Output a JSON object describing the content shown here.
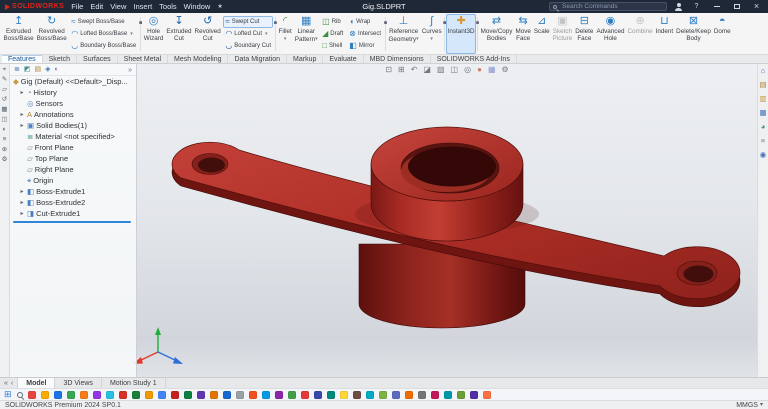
{
  "titlebar": {
    "logo_text": "SOLIDWORKS",
    "brand_color": "#e2231a",
    "menus": [
      "File",
      "Edit",
      "View",
      "Insert",
      "Tools",
      "Window"
    ],
    "pin_icon": "menu-pin-icon",
    "document_title": "Gig.SLDPRT",
    "search_placeholder": "Search Commands",
    "help_label": "?"
  },
  "ribbon": {
    "items": [
      {
        "icon": "extruded-boss-base-icon",
        "l1": "Extruded",
        "l2": "Boss/Base"
      },
      {
        "icon": "revolved-boss-base-icon",
        "l1": "Revolved",
        "l2": "Boss/Base"
      },
      {
        "stack": true,
        "items": [
          {
            "icon": "swept-boss-base-icon",
            "label": "Swept Boss/Base"
          },
          {
            "icon": "lofted-boss-base-icon",
            "label": "Lofted Boss/Base",
            "caret": true
          },
          {
            "icon": "boundary-boss-base-icon",
            "label": "Boundary Boss/Base"
          }
        ]
      },
      {
        "sep": true
      },
      {
        "icon": "hole-wizard-icon",
        "l1": "Hole",
        "l2": "Wizard"
      },
      {
        "icon": "extruded-cut-icon",
        "l1": "Extruded",
        "l2": "Cut"
      },
      {
        "icon": "revolved-cut-icon",
        "l1": "Revolved",
        "l2": "Cut"
      },
      {
        "stack": true,
        "items": [
          {
            "icon": "swept-cut-icon",
            "label": "Swept Cut",
            "highlight": true
          },
          {
            "icon": "lofted-cut-icon",
            "label": "Lofted Cut",
            "caret": true
          },
          {
            "icon": "boundary-cut-icon",
            "label": "Boundary Cut"
          }
        ]
      },
      {
        "sep": true
      },
      {
        "icon": "fillet-icon",
        "l1": "Fillet",
        "caret": true
      },
      {
        "icon": "linear-pattern-icon",
        "l1": "Linear",
        "l2": "Pattern",
        "caret": true
      },
      {
        "stack": true,
        "items": [
          {
            "icon": "rib-icon",
            "label": "Rib"
          },
          {
            "icon": "draft-icon",
            "label": "Draft"
          },
          {
            "icon": "shell-icon",
            "label": "Shell"
          }
        ]
      },
      {
        "stack": true,
        "items": [
          {
            "icon": "wrap-icon",
            "label": "Wrap"
          },
          {
            "icon": "intersect-icon",
            "label": "Intersect"
          },
          {
            "icon": "mirror-icon",
            "label": "Mirror"
          }
        ]
      },
      {
        "sep": true
      },
      {
        "icon": "reference-geometry-icon",
        "l1": "Reference",
        "l2": "Geometry",
        "caret": true
      },
      {
        "icon": "curves-icon",
        "l1": "Curves",
        "caret": true
      },
      {
        "sep": true
      },
      {
        "icon": "instant3d-icon",
        "l1": "Instant3D",
        "active": true
      },
      {
        "sep": true
      },
      {
        "icon": "move-copy-bodies-icon",
        "l1": "Move/Copy",
        "l2": "Bodies"
      },
      {
        "icon": "move-face-icon",
        "l1": "Move",
        "l2": "Face"
      },
      {
        "icon": "scale-icon",
        "l1": "Scale"
      },
      {
        "icon": "sketch-picture-icon",
        "l1": "Sketch",
        "l2": "Picture",
        "disabled": true
      },
      {
        "icon": "delete-face-icon",
        "l1": "Delete",
        "l2": "Face"
      },
      {
        "icon": "advanced-hole-icon",
        "l1": "Advanced",
        "l2": "Hole"
      },
      {
        "icon": "combine-icon",
        "l1": "Combine",
        "disabled": true
      },
      {
        "icon": "indent-icon",
        "l1": "Indent"
      },
      {
        "icon": "delete-keep-body-icon",
        "l1": "Delete/Keep",
        "l2": "Body"
      },
      {
        "icon": "dome-icon",
        "l1": "Dome"
      }
    ]
  },
  "command_tabs": {
    "tabs": [
      {
        "label": "Features",
        "active": true
      },
      {
        "label": "Sketch"
      },
      {
        "label": "Surfaces"
      },
      {
        "label": "Sheet Metal"
      },
      {
        "label": "Mesh Modeling"
      },
      {
        "label": "Data Migration"
      },
      {
        "label": "Markup"
      },
      {
        "label": "Evaluate"
      },
      {
        "label": "MBD Dimensions"
      },
      {
        "label": "SOLIDWORKS Add-Ins"
      }
    ]
  },
  "left_toolbar": {
    "icons": [
      "crosshair-tool-icon",
      "sketch-tool-icon",
      "plane-tool-icon",
      "rotate-tool-icon",
      "grid-tool-icon",
      "section-tool-icon",
      "appearance-tool-icon",
      "list-tool-icon",
      "zoom-tool-icon",
      "settings-tool-icon"
    ]
  },
  "viewport": {
    "headsup": [
      "zoom-fit-icon",
      "zoom-area-icon",
      "previous-view-icon",
      "section-view-icon",
      "view-orientation-icon",
      "display-style-icon",
      "hide-show-items-icon",
      "edit-appearance-icon",
      "apply-scene-icon",
      "view-settings-icon"
    ],
    "model_name": "Gig",
    "model_color": "#b23128"
  },
  "feature_tree": {
    "tabs": [
      "featuremanager-tab-icon",
      "propertymanager-tab-icon",
      "configurationmanager-tab-icon",
      "dimxpertmanager-tab-icon",
      "displaymanager-tab-icon"
    ],
    "flyout_icon": "tree-flyout-icon",
    "root": {
      "icon": "part-icon",
      "label": "Gig (Default) <<Default>_Disp..."
    },
    "items": [
      {
        "icon": "history-icon",
        "label": "History",
        "caret": true
      },
      {
        "icon": "sensors-icon",
        "label": "Sensors"
      },
      {
        "icon": "annotations-icon",
        "label": "Annotations",
        "caret": true
      },
      {
        "icon": "solid-bodies-icon",
        "label": "Solid Bodies(1)",
        "caret": true
      },
      {
        "icon": "material-icon",
        "label": "Material <not specified>"
      },
      {
        "icon": "plane-icon",
        "label": "Front Plane"
      },
      {
        "icon": "plane-icon",
        "label": "Top Plane"
      },
      {
        "icon": "plane-icon",
        "label": "Right Plane"
      },
      {
        "icon": "origin-icon",
        "label": "Origin"
      },
      {
        "icon": "boss-extrude-icon",
        "label": "Boss-Extrude1",
        "caret": true
      },
      {
        "icon": "boss-extrude-icon",
        "label": "Boss-Extrude2",
        "caret": true
      },
      {
        "icon": "cut-extrude-icon",
        "label": "Cut-Extrude1",
        "caret": true
      }
    ]
  },
  "task_pane": {
    "icons": [
      "solidworks-resources-icon",
      "design-library-icon",
      "file-explorer-icon",
      "view-palette-icon",
      "appearances-scenes-icon",
      "custom-properties-icon",
      "forum-icon"
    ]
  },
  "bottom_bar": {
    "controls": [
      "tab-scroll-left-icon",
      "tab-scroll-right-icon"
    ],
    "tabs": [
      {
        "label": "Model",
        "active": true
      },
      {
        "label": "3D Views"
      },
      {
        "label": "Motion Study 1"
      }
    ]
  },
  "taskbar": {
    "start_icon": "windows-start-icon",
    "apps": [
      {
        "color": "#e8453c"
      },
      {
        "color": "#f9ab00"
      },
      {
        "color": "#1a73e8"
      },
      {
        "color": "#34a853"
      },
      {
        "color": "#fa7b17"
      },
      {
        "color": "#9334e6"
      },
      {
        "color": "#24c1e0"
      },
      {
        "color": "#d93025"
      },
      {
        "color": "#188038"
      },
      {
        "color": "#f29900"
      },
      {
        "color": "#4285f4"
      },
      {
        "color": "#c5221f"
      },
      {
        "color": "#0b8043"
      },
      {
        "color": "#5f36b0"
      },
      {
        "color": "#e37400"
      },
      {
        "color": "#1967d2"
      },
      {
        "color": "#9aa0a6"
      },
      {
        "color": "#f4511e"
      },
      {
        "color": "#039be5"
      },
      {
        "color": "#8e24aa"
      },
      {
        "color": "#43a047"
      },
      {
        "color": "#e53935"
      },
      {
        "color": "#3949ab"
      },
      {
        "color": "#00897b"
      },
      {
        "color": "#fdd835"
      },
      {
        "color": "#6d4c41"
      },
      {
        "color": "#00acc1"
      },
      {
        "color": "#7cb342"
      },
      {
        "color": "#5c6bc0"
      },
      {
        "color": "#ef6c00"
      },
      {
        "color": "#757575"
      },
      {
        "color": "#c2185b"
      },
      {
        "color": "#0097a7"
      },
      {
        "color": "#689f38"
      },
      {
        "color": "#512da8"
      },
      {
        "color": "#ff7043"
      }
    ]
  },
  "status_bar": {
    "left": "SOLIDWORKS Premium 2024 SP0.1",
    "units": "MMGS",
    "caret_icon": "units-caret-icon"
  }
}
